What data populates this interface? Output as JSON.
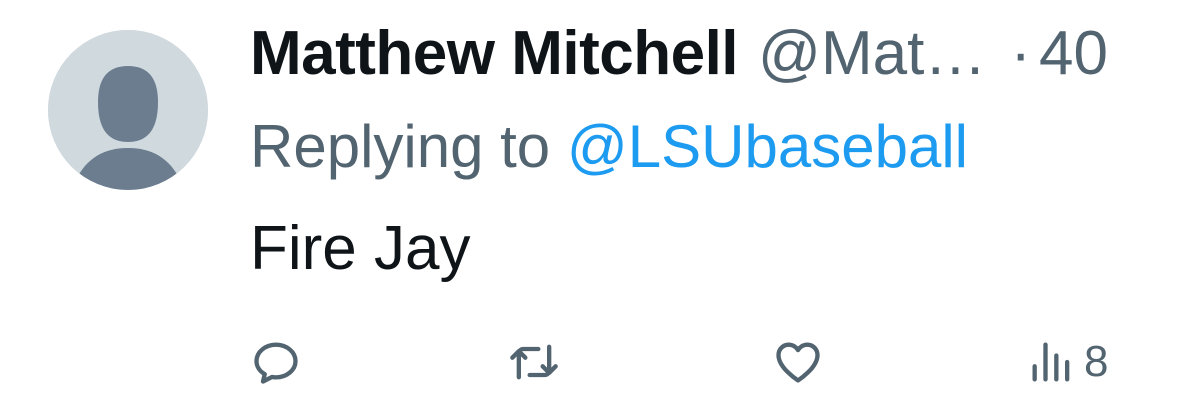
{
  "tweet": {
    "display_name": "Matthew Mitchell",
    "handle": "@Mat…",
    "separator": "·",
    "time": "40",
    "replying_prefix": "Replying to",
    "replying_to": "@LSUbaseball",
    "text": "Fire Jay"
  },
  "actions": {
    "reply_icon": "reply-icon",
    "retweet_icon": "retweet-icon",
    "like_icon": "heart-icon",
    "views_icon": "views-icon",
    "views_count": "8"
  },
  "colors": {
    "text": "#0f1419",
    "muted": "#536471",
    "link": "#1d9bf0",
    "avatar_bg": "#cfd9de",
    "avatar_fg": "#6b7d8f"
  }
}
